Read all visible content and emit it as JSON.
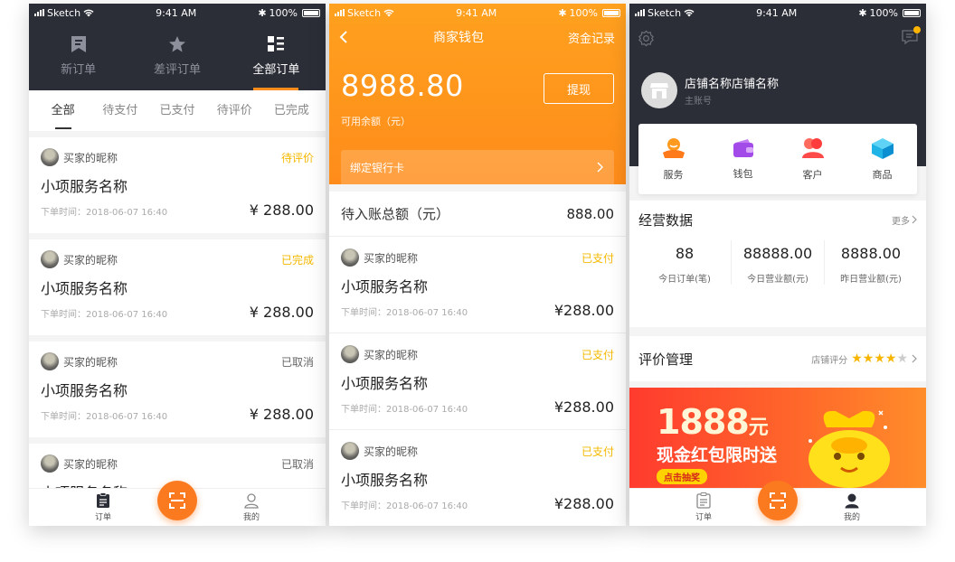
{
  "status_bar": {
    "carrier": "Sketch",
    "time": "9:41 AM",
    "battery": "100%"
  },
  "screen1": {
    "top_tabs": [
      {
        "label": "新订单",
        "icon": "bookmark-icon"
      },
      {
        "label": "差评订单",
        "icon": "star-icon"
      },
      {
        "label": "全部订单",
        "icon": "list-icon"
      }
    ],
    "filter_tabs": [
      "全部",
      "待支付",
      "已支付",
      "待评价",
      "已完成"
    ],
    "orders": [
      {
        "buyer": "买家的昵称",
        "status": "待评价",
        "service": "小项服务名称",
        "time": "下单时间：2018-06-07  16:40",
        "price": "¥ 288.00"
      },
      {
        "buyer": "买家的昵称",
        "status": "已完成",
        "service": "小项服务名称",
        "time": "下单时间：2018-06-07  16:40",
        "price": "¥ 288.00"
      },
      {
        "buyer": "买家的昵称",
        "status": "已取消",
        "service": "小项服务名称",
        "time": "下单时间：2018-06-07  16:40",
        "price": "¥ 288.00"
      },
      {
        "buyer": "买家的昵称",
        "status": "已取消",
        "service": "小项服务名称",
        "time": "",
        "price": ""
      }
    ],
    "nav": {
      "orders": "订单",
      "mine": "我的"
    }
  },
  "screen2": {
    "title": "商家钱包",
    "record_link": "资金记录",
    "balance": "8988.80",
    "balance_label": "可用余额（元）",
    "withdraw": "提现",
    "bind_card": "绑定银行卡",
    "pending_label": "待入账总额（元）",
    "pending_value": "888.00",
    "transactions": [
      {
        "buyer": "买家的昵称",
        "status": "已支付",
        "service": "小项服务名称",
        "time": "下单时间：2018-06-07  16:40",
        "price": "¥288.00"
      },
      {
        "buyer": "买家的昵称",
        "status": "已支付",
        "service": "小项服务名称",
        "time": "下单时间：2018-06-07  16:40",
        "price": "¥288.00"
      },
      {
        "buyer": "买家的昵称",
        "status": "已支付",
        "service": "小项服务名称",
        "time": "下单时间：2018-06-07  16:40",
        "price": "¥288.00"
      }
    ]
  },
  "screen3": {
    "shop_name": "店铺名称店铺名称",
    "account_type": "主账号",
    "quick_actions": [
      {
        "label": "服务",
        "icon": "service-icon"
      },
      {
        "label": "钱包",
        "icon": "wallet-icon"
      },
      {
        "label": "客户",
        "icon": "customers-icon"
      },
      {
        "label": "商品",
        "icon": "goods-box-icon"
      }
    ],
    "business": {
      "title": "经营数据",
      "more": "更多",
      "stats": [
        {
          "value": "88",
          "caption": "今日订单(笔)"
        },
        {
          "value": "88888.00",
          "caption": "今日营业额(元)"
        },
        {
          "value": "8888.00",
          "caption": "昨日营业额(元)"
        }
      ]
    },
    "review": {
      "title": "评价管理",
      "rating_label": "店铺评分",
      "rating": 3.5,
      "max": 5
    },
    "banner": {
      "amount": "1888",
      "unit": "元",
      "slogan": "现金红包限时送",
      "cta": "点击抽奖"
    },
    "nav": {
      "orders": "订单",
      "mine": "我的"
    }
  },
  "colors": {
    "orange": "#ff9a1e",
    "dark": "#2b2e37",
    "yellow": "#f5b800"
  }
}
